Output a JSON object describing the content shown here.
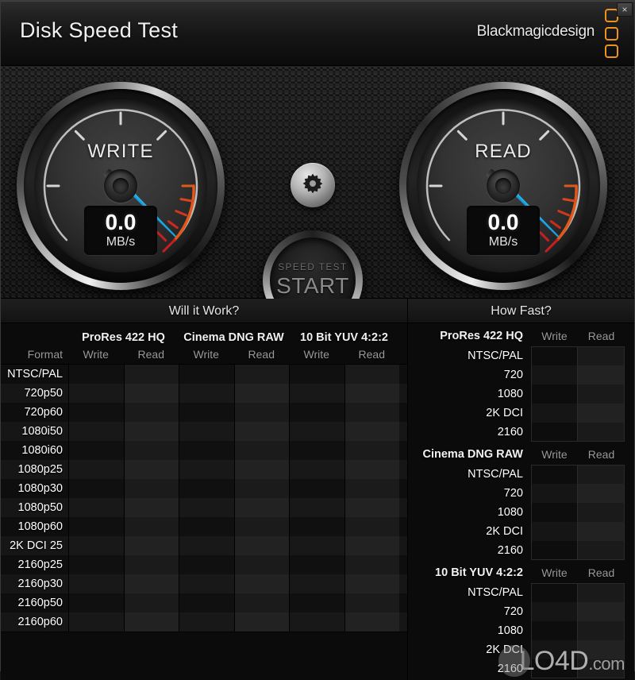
{
  "window": {
    "title": "Disk Speed Test",
    "brand": "Blackmagicdesign",
    "close_label": "×",
    "accent_orange": "#f0911e",
    "needle_blue": "#17a8e6"
  },
  "gauges": {
    "write": {
      "label": "WRITE",
      "value": "0.0",
      "unit": "MB/s",
      "angle_deg": 225
    },
    "read": {
      "label": "READ",
      "value": "0.0",
      "unit": "MB/s",
      "angle_deg": 225
    }
  },
  "controls": {
    "settings_icon": "gear-icon",
    "start": {
      "sublabel": "SPEED TEST",
      "label": "START"
    }
  },
  "will_it_work": {
    "heading": "Will it Work?",
    "format_header": "Format",
    "codecs": [
      "ProRes 422 HQ",
      "Cinema DNG RAW",
      "10 Bit YUV 4:2:2"
    ],
    "sub_headers": [
      "Write",
      "Read"
    ],
    "formats": [
      "NTSC/PAL",
      "720p50",
      "720p60",
      "1080i50",
      "1080i60",
      "1080p25",
      "1080p30",
      "1080p50",
      "1080p60",
      "2K DCI 25",
      "2160p25",
      "2160p30",
      "2160p50",
      "2160p60"
    ],
    "cells": []
  },
  "how_fast": {
    "heading": "How Fast?",
    "sub_headers": [
      "Write",
      "Read"
    ],
    "groups": [
      {
        "name": "ProRes 422 HQ",
        "rows": [
          "NTSC/PAL",
          "720",
          "1080",
          "2K DCI",
          "2160"
        ]
      },
      {
        "name": "Cinema DNG RAW",
        "rows": [
          "NTSC/PAL",
          "720",
          "1080",
          "2K DCI",
          "2160"
        ]
      },
      {
        "name": "10 Bit YUV 4:2:2",
        "rows": [
          "NTSC/PAL",
          "720",
          "1080",
          "2K DCI",
          "2160"
        ]
      }
    ]
  },
  "watermark": {
    "text": "LO4D",
    "suffix": ".com"
  }
}
